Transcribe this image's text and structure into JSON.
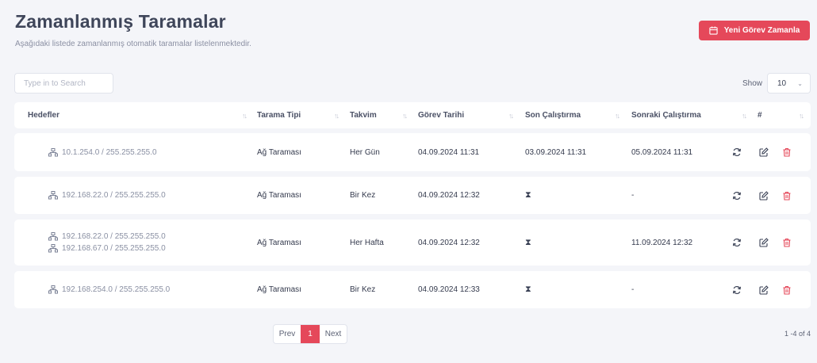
{
  "header": {
    "title": "Zamanlanmış Taramalar",
    "subtitle": "Aşağıdaki listede zamanlanmış otomatik taramalar listelenmektedir."
  },
  "actions": {
    "new_schedule_label": "Yeni Görev Zamanla"
  },
  "search": {
    "placeholder": "Type in to Search"
  },
  "show": {
    "label": "Show",
    "value": "10"
  },
  "table": {
    "columns": [
      "Hedefler",
      "Tarama Tipi",
      "Takvim",
      "Görev Tarihi",
      "Son Çalıştırma",
      "Sonraki Çalıştırma",
      "#"
    ],
    "rows": [
      {
        "targets": [
          "10.1.254.0 / 255.255.255.0"
        ],
        "type": "Ağ Taraması",
        "schedule": "Her Gün",
        "task_date": "04.09.2024 11:31",
        "last_run": "03.09.2024 11:31",
        "next_run": "05.09.2024 11:31"
      },
      {
        "targets": [
          "192.168.22.0 / 255.255.255.0"
        ],
        "type": "Ağ Taraması",
        "schedule": "Bir Kez",
        "task_date": "04.09.2024 12:32",
        "last_run": "⧗",
        "next_run": "-"
      },
      {
        "targets": [
          "192.168.22.0 / 255.255.255.0",
          "192.168.67.0 / 255.255.255.0"
        ],
        "type": "Ağ Taraması",
        "schedule": "Her Hafta",
        "task_date": "04.09.2024 12:32",
        "last_run": "⧗",
        "next_run": "11.09.2024 12:32"
      },
      {
        "targets": [
          "192.168.254.0 / 255.255.255.0"
        ],
        "type": "Ağ Taraması",
        "schedule": "Bir Kez",
        "task_date": "04.09.2024 12:33",
        "last_run": "⧗",
        "next_run": "-"
      }
    ]
  },
  "pagination": {
    "prev": "Prev",
    "current": "1",
    "next": "Next",
    "range": "1 -4 of 4"
  },
  "colors": {
    "accent": "#e5485a",
    "background": "#f4f5f9",
    "muted_text": "#8a90a3"
  },
  "icons": {
    "new_schedule": "calendar-icon",
    "target": "network-icon",
    "refresh": "refresh-icon",
    "edit": "edit-icon",
    "delete": "trash-icon"
  }
}
